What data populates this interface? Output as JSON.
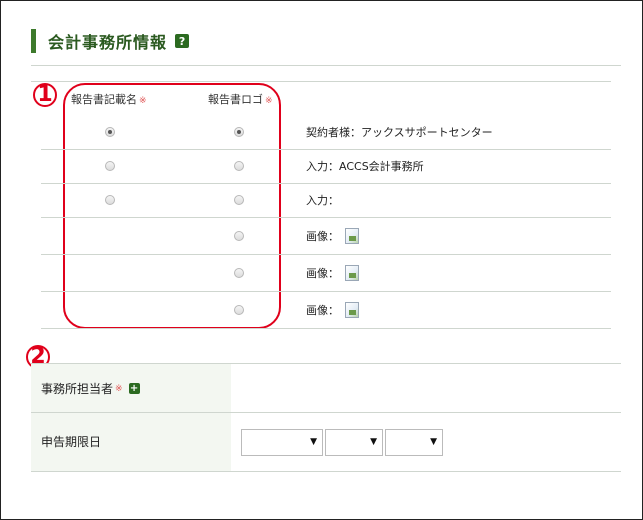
{
  "section": {
    "title": "会計事務所情報",
    "help_icon": "?"
  },
  "columns": {
    "report_name": "報告書記載名",
    "report_logo": "報告書ロゴ",
    "required_mark": "※"
  },
  "rows": [
    {
      "label": "契約者様：アックスサポートセンター",
      "has_name_radio": true,
      "name_checked": true,
      "logo_checked": true,
      "has_image": false
    },
    {
      "label": "入力：ACCS会計事務所",
      "has_name_radio": true,
      "name_checked": false,
      "logo_checked": false,
      "has_image": false
    },
    {
      "label": "入力：",
      "has_name_radio": true,
      "name_checked": false,
      "logo_checked": false,
      "has_image": false
    },
    {
      "label": "画像：",
      "has_name_radio": false,
      "name_checked": false,
      "logo_checked": false,
      "has_image": true
    },
    {
      "label": "画像：",
      "has_name_radio": false,
      "name_checked": false,
      "logo_checked": false,
      "has_image": true
    },
    {
      "label": "画像：",
      "has_name_radio": false,
      "name_checked": false,
      "logo_checked": false,
      "has_image": true
    }
  ],
  "annotations": {
    "one": "1",
    "two": "2"
  },
  "form": {
    "staff_label": "事務所担当者",
    "staff_required": "※",
    "staff_add": "+",
    "deadline_label": "申告期限日",
    "selects": [
      {
        "value": "",
        "arrow": "▼"
      },
      {
        "value": "",
        "arrow": "▼"
      },
      {
        "value": "",
        "arrow": "▼"
      }
    ]
  },
  "colors": {
    "accent": "#3d7a2c",
    "annotation": "#e0001b",
    "label_bg": "#f3f7f1"
  }
}
